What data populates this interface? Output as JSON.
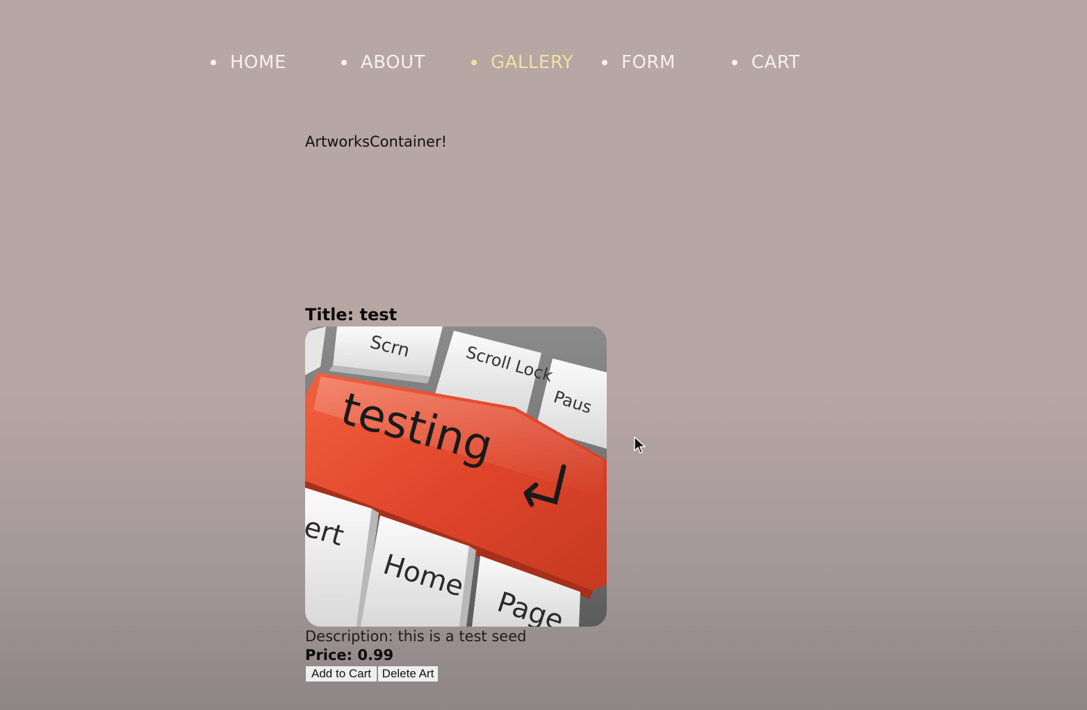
{
  "nav": {
    "items": [
      {
        "label": "HOME",
        "active": false
      },
      {
        "label": "ABOUT",
        "active": false
      },
      {
        "label": "GALLERY",
        "active": true
      },
      {
        "label": "FORM",
        "active": false
      },
      {
        "label": "CART",
        "active": false
      }
    ],
    "active_color": "#f2e19f",
    "text_color": "#f6f0ee"
  },
  "main": {
    "heading": "ArtworksContainer!",
    "artwork": {
      "title": "Title: test",
      "image_keys": {
        "top_left": "Scrn",
        "top_middle": "Scroll Lock",
        "top_right": "Paus",
        "main": "testing",
        "bottom_left": "ert",
        "bottom_middle": "Home",
        "bottom_right": "Page"
      },
      "description": "Description: this is a test seed",
      "price": "Price: 0.99",
      "add_to_cart_label": "Add to Cart",
      "delete_label": "Delete Art"
    }
  },
  "colors": {
    "background": "#b6a6a4",
    "key_red": "#e0452b"
  }
}
